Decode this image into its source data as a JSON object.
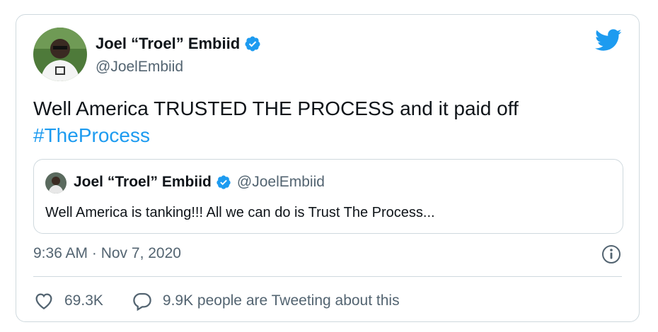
{
  "tweet": {
    "author": {
      "name": "Joel “Troel” Embiid",
      "handle": "@JoelEmbiid"
    },
    "text": "Well America TRUSTED THE PROCESS and it paid off",
    "hashtag": "#TheProcess",
    "quoted": {
      "name": "Joel “Troel” Embiid",
      "handle": "@JoelEmbiid",
      "text": "Well America is tanking!!! All we can do is Trust The Process..."
    },
    "timestamp": "9:36 AM · Nov 7, 2020",
    "likes": "69.3K",
    "conversation": "9.9K people are Tweeting about this"
  },
  "icons": {
    "brand": "twitter-bird-icon",
    "verified": "verified-badge-icon",
    "info": "info-icon",
    "like": "heart-icon",
    "reply": "reply-bubble-icon"
  },
  "colors": {
    "accent": "#1d9bf0",
    "text": "#0f1419",
    "muted": "#536471",
    "border": "#cfd9de"
  }
}
